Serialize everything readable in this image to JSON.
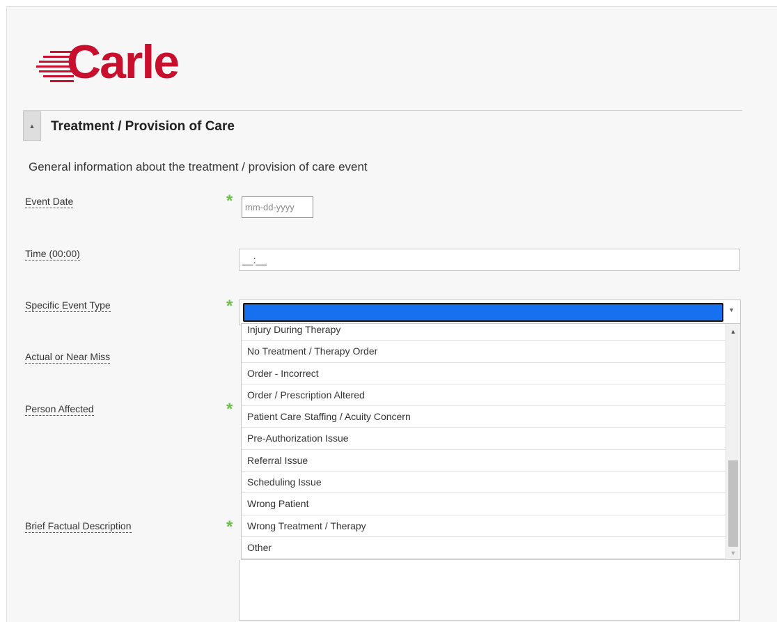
{
  "logo": {
    "text": "Carle",
    "color": "#c8102e"
  },
  "section": {
    "collapse_icon": "triangle-up-icon",
    "title": "Treatment / Provision of Care",
    "description": "General information about the treatment / provision of care event"
  },
  "fields": {
    "event_date": {
      "label": "Event Date",
      "placeholder": "mm-dd-yyyy",
      "required_mark": "*"
    },
    "time": {
      "label": "Time (00:00)",
      "value": "__:__"
    },
    "specific_event_type": {
      "label": "Specific Event Type",
      "required_mark": "*",
      "selected": ""
    },
    "actual_or_near_miss": {
      "label": "Actual or Near Miss"
    },
    "person_affected": {
      "label": "Person Affected",
      "required_mark": "*"
    },
    "brief_factual_description": {
      "label": "Brief Factual Description",
      "required_mark": "*"
    }
  },
  "dropdown": {
    "options": [
      "Injury During Therapy",
      "No Treatment / Therapy Order",
      "Order - Incorrect",
      "Order / Prescription Altered",
      "Patient Care Staffing / Acuity Concern",
      "Pre-Authorization Issue",
      "Referral Issue",
      "Scheduling Issue",
      "Wrong Patient",
      "Wrong Treatment / Therapy",
      "Other"
    ],
    "highlight_color": "#1670f0"
  },
  "colors": {
    "brand_red": "#c8102e",
    "required_green": "#6cc04a"
  }
}
